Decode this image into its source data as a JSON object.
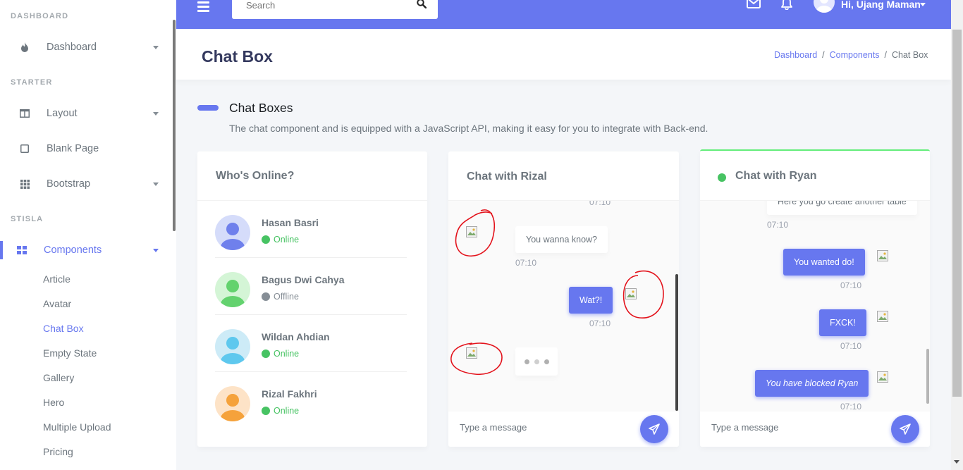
{
  "sidebar": {
    "headers": {
      "dashboard": "DASHBOARD",
      "starter": "STARTER",
      "stisla": "STISLA"
    },
    "items": {
      "dashboard": "Dashboard",
      "layout": "Layout",
      "blank_page": "Blank Page",
      "bootstrap": "Bootstrap",
      "components": "Components"
    },
    "sub_items": [
      "Article",
      "Avatar",
      "Chat Box",
      "Empty State",
      "Gallery",
      "Hero",
      "Multiple Upload",
      "Pricing"
    ]
  },
  "navbar": {
    "search_placeholder": "Search",
    "user_greeting": "Hi, Ujang Maman"
  },
  "page": {
    "title": "Chat Box",
    "breadcrumb": [
      "Dashboard",
      "Components",
      "Chat Box"
    ]
  },
  "section": {
    "title": "Chat Boxes",
    "lead": "The chat component and is equipped with a JavaScript API, making it easy for you to integrate with Back-end."
  },
  "who_online": {
    "title": "Who's Online?",
    "users": [
      {
        "name": "Hasan Basri",
        "status": "Online"
      },
      {
        "name": "Bagus Dwi Cahya",
        "status": "Offline"
      },
      {
        "name": "Wildan Ahdian",
        "status": "Online"
      },
      {
        "name": "Rizal Fakhri",
        "status": "Online"
      }
    ]
  },
  "chat_rizal": {
    "title": "Chat with Rizal",
    "messages": [
      {
        "text": "",
        "time": "07:10"
      },
      {
        "text": "You wanna know?",
        "time": "07:10"
      },
      {
        "text": "Wat?!",
        "time": "07:10"
      }
    ],
    "placeholder": "Type a message"
  },
  "chat_ryan": {
    "title": "Chat with Ryan",
    "messages": [
      {
        "text": "Here you go create another table",
        "time": "07:10"
      },
      {
        "text": "You wanted do!",
        "time": "07:10"
      },
      {
        "text": "FXCK!",
        "time": "07:10"
      },
      {
        "text": "You have blocked Ryan",
        "time": "07:10"
      }
    ],
    "placeholder": "Type a message"
  },
  "colors": {
    "primary": "#6777ef",
    "online": "#47c363",
    "offline": "#868e96",
    "annotation": "#e3121b"
  }
}
